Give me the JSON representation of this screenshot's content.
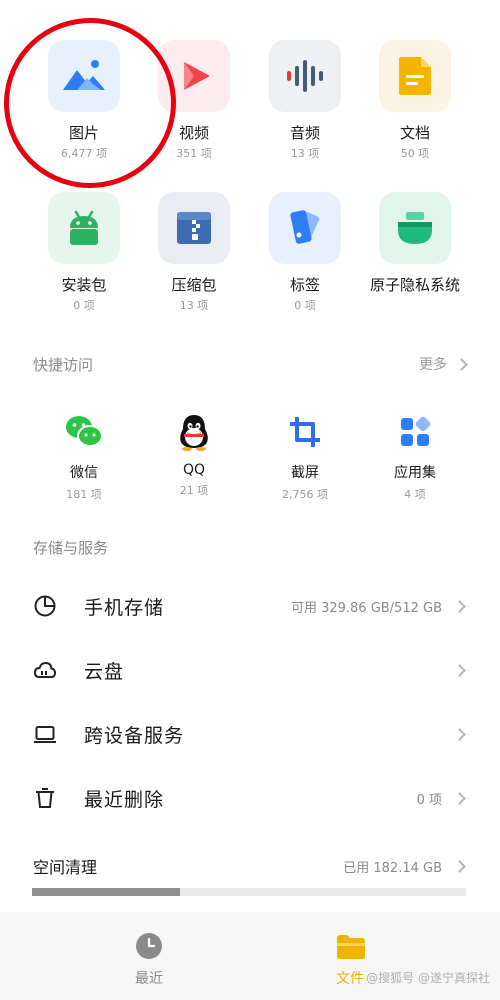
{
  "categories": [
    {
      "name": "图片",
      "count": "6,477 项",
      "icon": "image-icon",
      "bg": "#e6f1fd"
    },
    {
      "name": "视频",
      "count": "351 项",
      "icon": "video-icon",
      "bg": "#fdeced"
    },
    {
      "name": "音频",
      "count": "13 项",
      "icon": "audio-icon",
      "bg": "#eef0f3"
    },
    {
      "name": "文档",
      "count": "50 项",
      "icon": "document-icon",
      "bg": "#fdf3e2"
    },
    {
      "name": "安装包",
      "count": "0 项",
      "icon": "android-icon",
      "bg": "#e6f6ec"
    },
    {
      "name": "压缩包",
      "count": "13 项",
      "icon": "zip-icon",
      "bg": "#e9edf3"
    },
    {
      "name": "标签",
      "count": "0 项",
      "icon": "tag-icon",
      "bg": "#e6f1fd"
    },
    {
      "name": "原子隐私系统",
      "count": "",
      "icon": "privacy-icon",
      "bg": "#e2f5ed"
    }
  ],
  "quick_access": {
    "title": "快捷访问",
    "more": "更多",
    "items": [
      {
        "name": "微信",
        "count": "181 项",
        "icon": "wechat-icon"
      },
      {
        "name": "QQ",
        "count": "21 项",
        "icon": "qq-icon"
      },
      {
        "name": "截屏",
        "count": "2,756 项",
        "icon": "crop-icon"
      },
      {
        "name": "应用集",
        "count": "4 项",
        "icon": "app-collection-icon"
      }
    ]
  },
  "storage": {
    "title": "存储与服务",
    "rows": [
      {
        "label": "手机存储",
        "value": "可用 329.86 GB/512 GB",
        "icon": "pie-chart-icon"
      },
      {
        "label": "云盘",
        "value": "",
        "icon": "cloud-icon"
      },
      {
        "label": "跨设备服务",
        "value": "",
        "icon": "laptop-icon"
      },
      {
        "label": "最近删除",
        "value": "0 项",
        "icon": "trash-icon"
      }
    ]
  },
  "cleanup": {
    "label": "空间清理",
    "value": "已用 182.14 GB",
    "used_fraction": 0.34
  },
  "bottom_nav": [
    {
      "name": "最近",
      "icon": "clock-icon",
      "active": false
    },
    {
      "name": "文件",
      "icon": "folder-icon",
      "active": true
    }
  ],
  "watermark": "@搜狐号 @遂宁真探社",
  "colors": {
    "accent": "#f0b400",
    "highlight_circle": "#e60012"
  }
}
